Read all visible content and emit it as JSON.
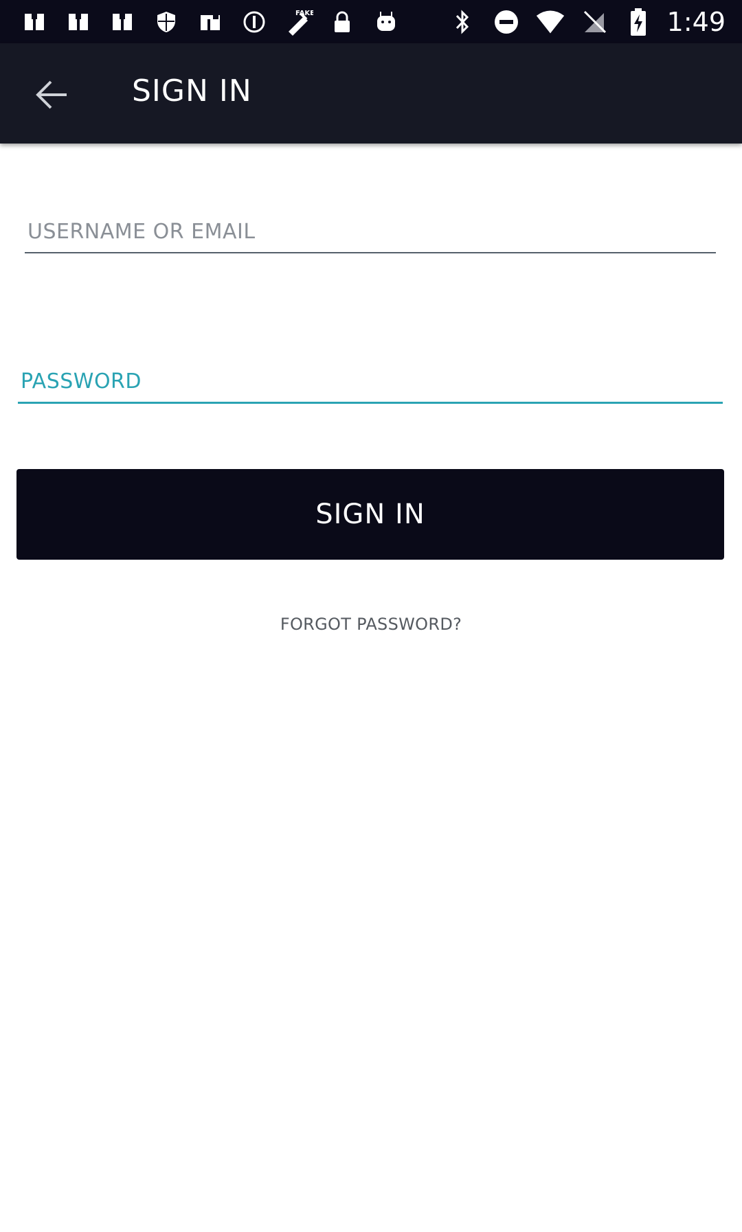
{
  "status_bar": {
    "time": "1:49",
    "left_icons": [
      "notification-icon",
      "notification-icon",
      "notification-icon",
      "shield-icon",
      "notification-icon",
      "alert-circle-icon",
      "fake-gps-icon",
      "lock-icon",
      "android-icon"
    ],
    "right_icons": [
      "bluetooth-icon",
      "do-not-disturb-icon",
      "wifi-icon",
      "no-sim-icon",
      "battery-charging-icon"
    ]
  },
  "app_bar": {
    "title": "SIGN IN",
    "back_icon": "arrow-left-icon"
  },
  "form": {
    "username_placeholder": "USERNAME OR EMAIL",
    "username_value": "",
    "password_placeholder": "PASSWORD",
    "password_value": "",
    "sign_in_label": "SIGN IN",
    "forgot_label": "FORGOT PASSWORD?"
  },
  "colors": {
    "status_bar_bg": "#0b0b1a",
    "app_bar_bg": "#161824",
    "button_bg": "#0a0a18",
    "focus_accent": "#2aa3b3"
  }
}
